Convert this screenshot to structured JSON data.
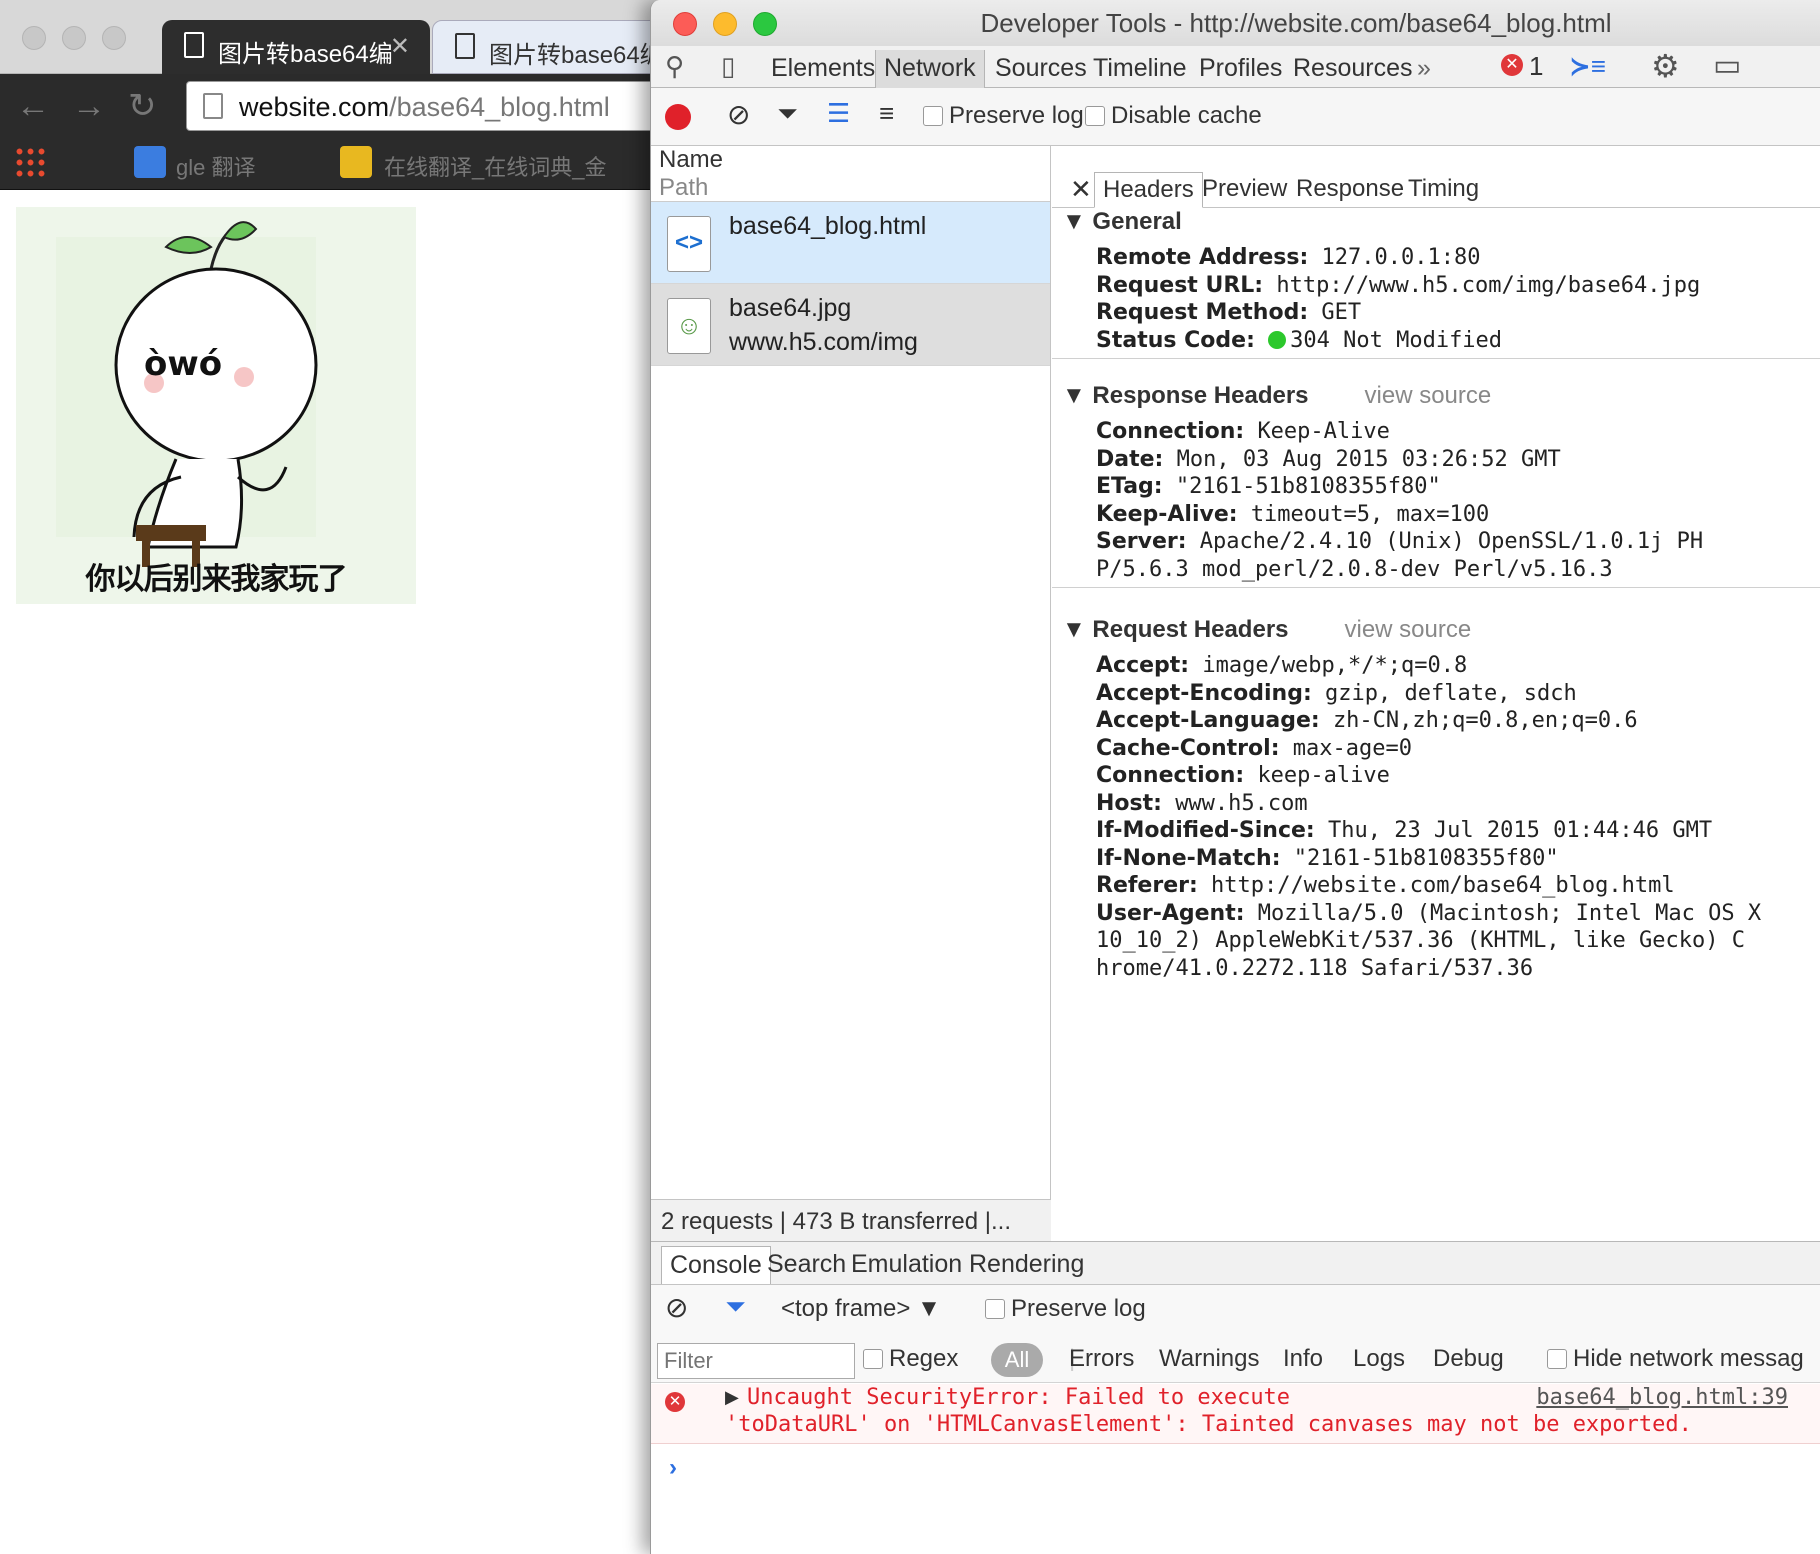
{
  "browser": {
    "tabs": [
      {
        "label": "图片转base64编",
        "active": true
      },
      {
        "label": "图片转base64编",
        "active": false
      }
    ],
    "url": {
      "host": "website.com",
      "path": "/base64_blog.html"
    },
    "bookmarks": [
      "gle 翻译",
      "在线翻译_在线词典_金"
    ],
    "page_image_caption": "你以后别来我家玩了",
    "page_image_face": "òwó"
  },
  "devtools": {
    "title": "Developer Tools - http://website.com/base64_blog.html",
    "panels": [
      "Elements",
      "Network",
      "Sources",
      "Timeline",
      "Profiles",
      "Resources"
    ],
    "active_panel": "Network",
    "more_panels": "»",
    "error_count": "1",
    "network_toolbar": {
      "preserve_log": "Preserve log",
      "disable_cache": "Disable cache"
    },
    "request_list": {
      "col_name": "Name",
      "col_path": "Path",
      "rows": [
        {
          "name": "base64_blog.html",
          "path": "",
          "icon": "<>"
        },
        {
          "name": "base64.jpg",
          "path": "www.h5.com/img",
          "icon": "img"
        }
      ],
      "summary": "2 requests | 473 B transferred |..."
    },
    "detail_tabs": [
      "Headers",
      "Preview",
      "Response",
      "Timing"
    ],
    "general": {
      "title": "General",
      "rows": [
        {
          "k": "Remote Address:",
          "v": "127.0.0.1:80"
        },
        {
          "k": "Request URL:",
          "v": "http://www.h5.com/img/base64.jpg"
        },
        {
          "k": "Request Method:",
          "v": "GET"
        },
        {
          "k": "Status Code:",
          "v": "304 Not Modified"
        }
      ],
      "status_color": "#2cc82c"
    },
    "response_headers": {
      "title": "Response Headers",
      "view_source": "view source",
      "rows": [
        {
          "k": "Connection:",
          "v": "Keep-Alive"
        },
        {
          "k": "Date:",
          "v": "Mon, 03 Aug 2015 03:26:52 GMT"
        },
        {
          "k": "ETag:",
          "v": "\"2161-51b8108355f80\""
        },
        {
          "k": "Keep-Alive:",
          "v": "timeout=5, max=100"
        },
        {
          "k": "Server:",
          "v": "Apache/2.4.10 (Unix) OpenSSL/1.0.1j PH"
        },
        {
          "k": "",
          "v": "P/5.6.3 mod_perl/2.0.8-dev Perl/v5.16.3"
        }
      ]
    },
    "request_headers": {
      "title": "Request Headers",
      "view_source": "view source",
      "rows": [
        {
          "k": "Accept:",
          "v": "image/webp,*/*;q=0.8"
        },
        {
          "k": "Accept-Encoding:",
          "v": "gzip, deflate, sdch"
        },
        {
          "k": "Accept-Language:",
          "v": "zh-CN,zh;q=0.8,en;q=0.6"
        },
        {
          "k": "Cache-Control:",
          "v": "max-age=0"
        },
        {
          "k": "Connection:",
          "v": "keep-alive"
        },
        {
          "k": "Host:",
          "v": "www.h5.com"
        },
        {
          "k": "If-Modified-Since:",
          "v": "Thu, 23 Jul 2015 01:44:46 GMT"
        },
        {
          "k": "If-None-Match:",
          "v": "\"2161-51b8108355f80\""
        },
        {
          "k": "Referer:",
          "v": "http://website.com/base64_blog.html"
        },
        {
          "k": "User-Agent:",
          "v": "Mozilla/5.0 (Macintosh; Intel Mac OS X"
        },
        {
          "k": "",
          "v": "10_10_2) AppleWebKit/537.36 (KHTML, like Gecko) C"
        },
        {
          "k": "",
          "v": "hrome/41.0.2272.118 Safari/537.36"
        }
      ]
    },
    "drawer_tabs": [
      "Console",
      "Search",
      "Emulation",
      "Rendering"
    ],
    "console": {
      "frame": "<top frame>",
      "preserve_log": "Preserve log",
      "filter_placeholder": "Filter",
      "regex": "Regex",
      "levels": [
        "All",
        "Errors",
        "Warnings",
        "Info",
        "Logs",
        "Debug"
      ],
      "hide_network": "Hide network messag",
      "error_line1": "Uncaught SecurityError: Failed to execute",
      "error_line2": "'toDataURL' on 'HTMLCanvasElement': Tainted canvases may not be exported.",
      "error_source": "base64_blog.html:39",
      "prompt": "›"
    }
  }
}
